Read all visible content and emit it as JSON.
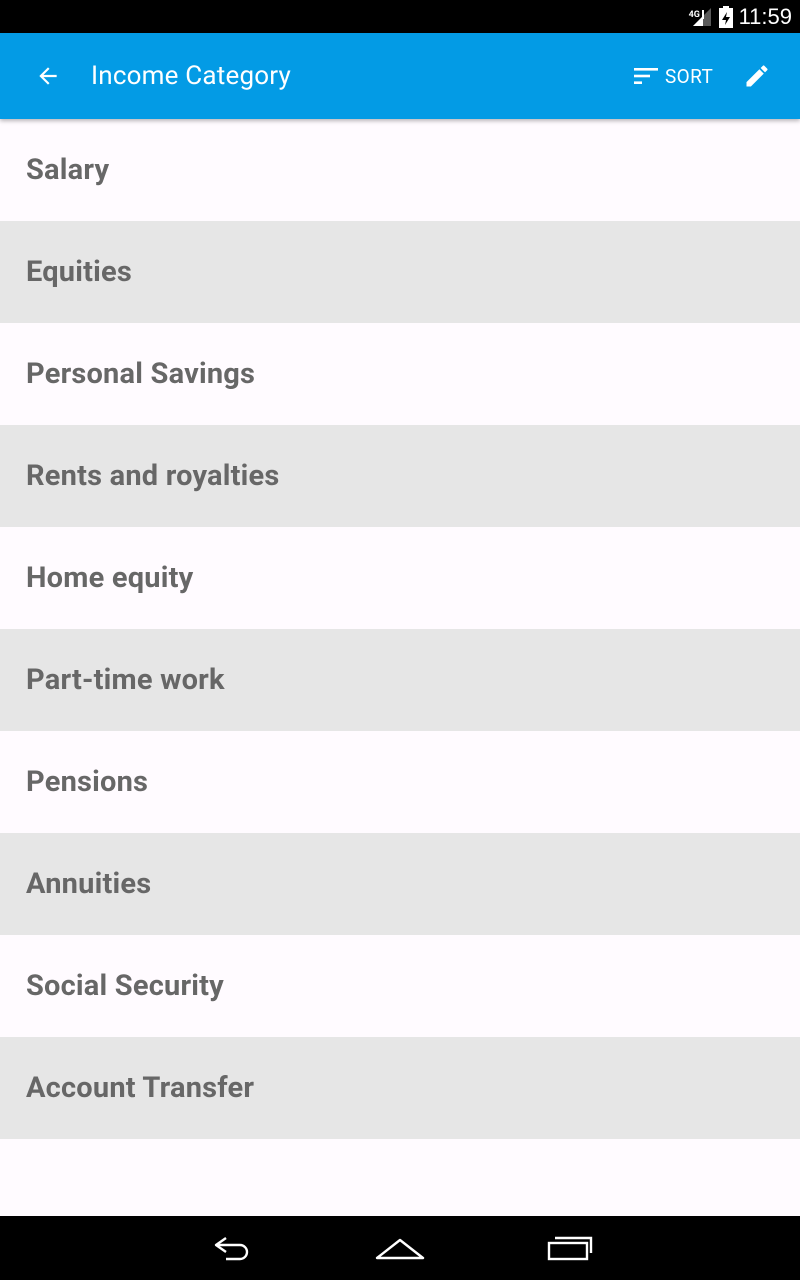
{
  "status_bar": {
    "network": "4G",
    "time": "11:59"
  },
  "app_bar": {
    "title": "Income Category",
    "sort_label": "SORT",
    "background_color": "#039be5",
    "icons": {
      "back": "arrow-back-icon",
      "sort": "sort-lines-icon",
      "edit": "pencil-icon"
    }
  },
  "categories": [
    "Salary",
    "Equities",
    "Personal Savings",
    "Rents and royalties",
    "Home equity",
    "Part-time work",
    "Pensions",
    "Annuities",
    "Social Security",
    "Account Transfer"
  ],
  "nav_bar": {
    "icons": [
      "back-nav-icon",
      "home-nav-icon",
      "recents-nav-icon"
    ]
  },
  "colors": {
    "row_light": "#fffbff",
    "row_dark": "#e6e6e6",
    "row_text": "#676767"
  }
}
